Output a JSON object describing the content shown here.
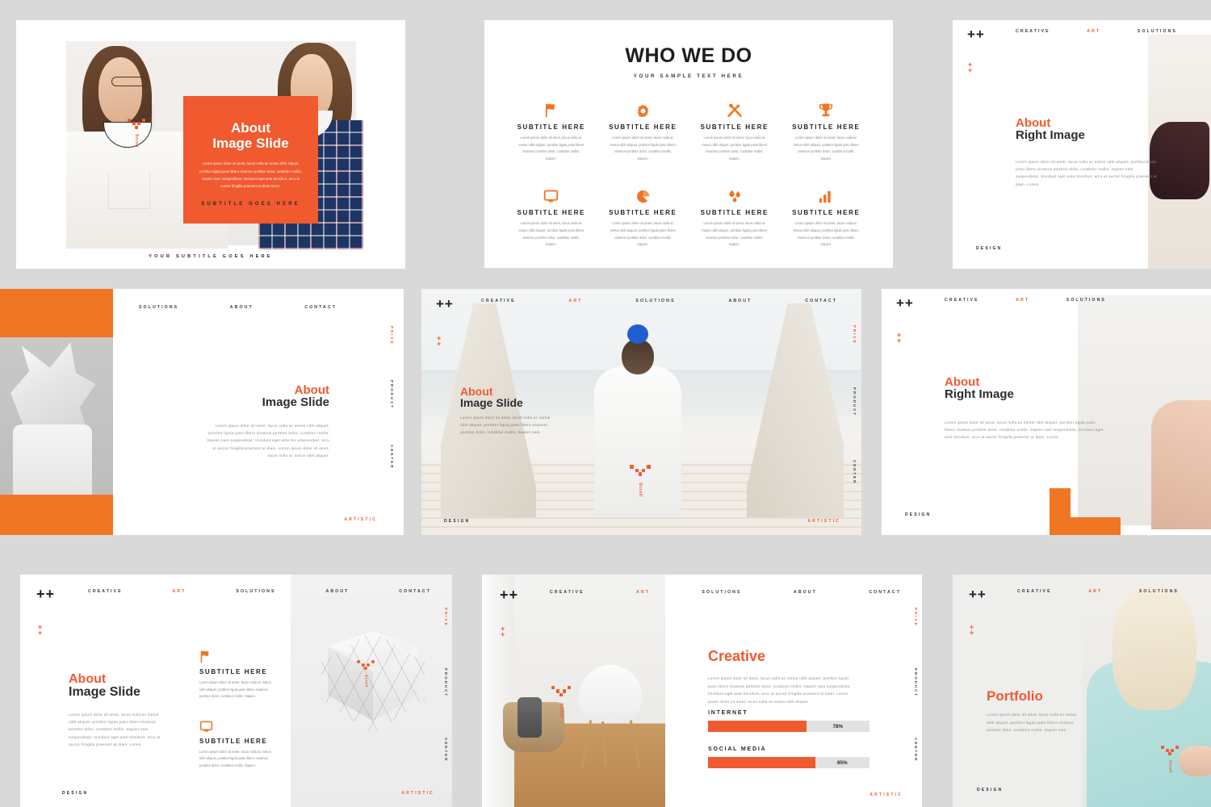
{
  "theme": {
    "accent": "#f05a2e",
    "accent_alt": "#ef7622",
    "page_bg": "#d9d9d9",
    "dark": "#2d2d2d"
  },
  "common": {
    "logo": "++",
    "mini_plus": "+",
    "scroll_word": "Scroll",
    "lorem_short": "Lorem ipsum dolor sit amet, lacus nulla ac metus nibh aliquet, porttitor ligula justo libero vivamus porttitor dolor, curabitur mollis.",
    "lorem_med": "Lorem ipsum dolor sit amet, lacus nulla ac metus nibh aliquet, porttitor ligula justo libero vivamus porttitor dolor, curabitur mollis. Sapien nam suspendisse, tincidunt eget ante tincidunt.",
    "lorem_long": "Lorem ipsum dolor sit amet, lacus nulla ac metus nibh aliquet, porttitor ligula justo libero vivamus porttitor dolor, curabitur mollis. Sapien nam suspendisse, tincidunt eget ante leo ullamcorper, arcu at auctor fringilla praesent at diam. Lorem ipsum dolor sit amet, lacus nulla ac metus nibh aliquet.",
    "lorem_card": "Lorem ipsum dolor sit amet, lacus nulla ac metus nibh aliquet, porttitor ligula justo libero vivamus porttitor dolor, curabitur mollis. Sapien.",
    "footer_design": "DESIGN",
    "footer_artistic": "ARTISTIC",
    "side_labels": [
      "PRICE",
      "PRODUCT",
      "CENTER"
    ]
  },
  "slide1": {
    "heading_line1": "About",
    "heading_line2": "Image Slide",
    "body": "Lorem ipsum dolor sit amet, lacus nulla ac metus nibh aliquet, porttitor ligula justo libero vivamus porttitor dolor, curabitur mollis, Sapien nam suspendisse, tincidunt eget ante tincidunt, arcu at auctor fringilla praesent at diam lorem.",
    "box_subtitle": "SUBTITLE GOES HERE",
    "footer": "YOUR SUBTITLE GOES HERE",
    "scroll": "Scroll"
  },
  "slide2": {
    "title": "WHO WE DO",
    "subtitle": "YOUR SAMPLE TEXT HERE",
    "items": [
      {
        "icon": "flag-icon",
        "heading": "SUBTITLE HERE",
        "body": "Lorem ipsum dolor sit amet, lacus nulla ac metus nibh aliquet, porttitor ligula justo libero vivamus porttitor dolor, curabitur mollis. Sapien."
      },
      {
        "icon": "gear-icon",
        "heading": "SUBTITLE HERE",
        "body": "Lorem ipsum dolor sit amet, lacus nulla ac metus nibh aliquet, porttitor ligula justo libero vivamus porttitor dolor, curabitur mollis. Sapien."
      },
      {
        "icon": "tools-icon",
        "heading": "SUBTITLE HERE",
        "body": "Lorem ipsum dolor sit amet, lacus nulla ac metus nibh aliquet, porttitor ligula justo libero vivamus porttitor dolor, curabitur mollis. Sapien."
      },
      {
        "icon": "trophy-icon",
        "heading": "SUBTITLE HERE",
        "body": "Lorem ipsum dolor sit amet, lacus nulla ac metus nibh aliquet, porttitor ligula justo libero vivamus porttitor dolor, curabitur mollis. Sapien."
      },
      {
        "icon": "monitor-icon",
        "heading": "SUBTITLE HERE",
        "body": "Lorem ipsum dolor sit amet, lacus nulla ac metus nibh aliquet, porttitor ligula justo libero vivamus porttitor dolor, curabitur mollis. Sapien."
      },
      {
        "icon": "pie-chart-icon",
        "heading": "SUBTITLE HERE",
        "body": "Lorem ipsum dolor sit amet, lacus nulla ac metus nibh aliquet, porttitor ligula justo libero vivamus porttitor dolor, curabitur mollis. Sapien."
      },
      {
        "icon": "water-drop-icon",
        "heading": "SUBTITLE HERE",
        "body": "Lorem ipsum dolor sit amet, lacus nulla ac metus nibh aliquet, porttitor ligula justo libero vivamus porttitor dolor, curabitur mollis. Sapien."
      },
      {
        "icon": "bar-chart-icon",
        "heading": "SUBTITLE HERE",
        "body": "Lorem ipsum dolor sit amet, lacus nulla ac metus nibh aliquet, porttitor ligula justo libero vivamus porttitor dolor, curabitur mollis. Sapien."
      }
    ]
  },
  "slide3": {
    "nav": [
      "CREATIVE",
      "ART",
      "SOLUTIONS"
    ],
    "heading_line1": "About",
    "heading_line2": "Right Image",
    "body": "Lorem ipsum dolor sit amet, lacus nulla ac metus nibh aliquet, porttitor ligula justo libero vivamus porttitor dolor, curabitur mollis. Sapien nam suspendisse, tincidunt eget ante tincidunt, arcu at auctor fringilla praesent at diam. Lorem.",
    "footer": "DESIGN"
  },
  "slide4": {
    "nav": [
      "SOLUTIONS",
      "ABOUT",
      "CONTACT"
    ],
    "side_labels": [
      "PRICE",
      "PRODUCT",
      "CENTER"
    ],
    "heading_line1": "About",
    "heading_line2": "Image Slide",
    "body": "Lorem ipsum dolor sit amet, lacus nulla ac metus nibh aliquet, porttitor ligula justo libero vivamus porttitor dolor, curabitur mollis. Sapien nam suspendisse, tincidunt eget ante leo ullamcorper, arcu at auctor fringilla praesent at diam. Lorem ipsum dolor sit amet, lacus nulla ac metus nibh aliquet.",
    "footer": "ARTISTIC"
  },
  "slide5": {
    "nav": [
      "CREATIVE",
      "ART",
      "SOLUTIONS",
      "ABOUT",
      "CONTACT"
    ],
    "side_labels": [
      "PRICE",
      "PRODUCT",
      "CENTER"
    ],
    "heading_line1": "About",
    "heading_line2": "Image Slide",
    "body": "Lorem ipsum dolor sit amet, lacus nulla ac metus nibh aliquet, porttitor ligula justo libero vivamus porttitor dolor, curabitur mollis. Sapien nam.",
    "footer_left": "DESIGN",
    "footer_right": "ARTISTIC",
    "scroll": "Scroll"
  },
  "slide6": {
    "nav": [
      "CREATIVE",
      "ART",
      "SOLUTIONS"
    ],
    "heading_line1": "About",
    "heading_line2": "Right Image",
    "body": "Lorem ipsum dolor sit amet, lacus nulla ac metus nibh aliquet, porttitor ligula justo libero vivamus porttitor dolor, curabitur mollis. Sapien nam suspendisse, tincidunt eget ante tincidunt, arcu at auctor fringilla praesent at diam. Lorem.",
    "footer": "DESIGN"
  },
  "slide7": {
    "nav": [
      "CREATIVE",
      "ART",
      "SOLUTIONS",
      "ABOUT",
      "CONTACT"
    ],
    "side_labels": [
      "PRICE",
      "PRODUCT",
      "CENTER"
    ],
    "heading_line1": "About",
    "heading_line2": "Image Slide",
    "body": "Lorem ipsum dolor sit amet, lacus nulla ac metus nibh aliquet, porttitor ligula justo libero vivamus porttitor dolor, curabitur mollis. Sapien nam suspendisse, tincidunt eget ante tincidunt, arcu at auctor fringilla praesent at diam. Lorem.",
    "features": [
      {
        "icon": "flag-icon",
        "heading": "SUBTITLE HERE",
        "body": "Lorem ipsum dolor sit amet, lacus nulla ac metus nibh aliquet, porttitor ligula justo libero vivamus porttitor dolor, curabitur mollis. Sapien."
      },
      {
        "icon": "monitor-icon",
        "heading": "SUBTITLE HERE",
        "body": "Lorem ipsum dolor sit amet, lacus nulla ac metus nibh aliquet, porttitor ligula justo libero vivamus porttitor dolor, curabitur mollis. Sapien."
      }
    ],
    "footer_left": "DESIGN",
    "footer_right": "ARTISTIC",
    "scroll": "Scroll"
  },
  "slide8": {
    "nav": [
      "CREATIVE",
      "ART",
      "SOLUTIONS",
      "ABOUT",
      "CONTACT"
    ],
    "side_labels": [
      "PRICE",
      "PRODUCT",
      "CENTER"
    ],
    "heading": "Creative",
    "body": "Lorem ipsum dolor sit amet, lacus nulla ac metus nibh aliquet, porttitor ligula justo libero vivamus porttitor dolor, curabitur mollis. Sapien nam suspendisse, tincidunt eget ante tincidunt, arcu at auctor fringilla praesent at diam. Lorem ipsum dolor sit amet, lacus nulla ac metus nibh aliquet.",
    "footer_right": "ARTISTIC",
    "scroll": "Scroll",
    "chart_data": {
      "type": "bar",
      "title": "Creative",
      "orientation": "horizontal",
      "categories": [
        "INTERNET",
        "SOCIAL MEDIA"
      ],
      "values": [
        78,
        85
      ],
      "value_labels": [
        "78%",
        "85%"
      ],
      "unit": "%",
      "xlim": [
        0,
        100
      ],
      "grid": false,
      "legend": "none",
      "bar_color": "#f05a2e",
      "track_color": "#e2e2e2"
    }
  },
  "slide9": {
    "nav": [
      "CREATIVE",
      "ART",
      "SOLUTIONS"
    ],
    "heading": "Portfolio",
    "body": "Lorem ipsum dolor sit amet, lacus nulla ac metus nibh aliquet, porttitor ligula justo libero vivamus porttitor dolor, curabitur mollis. Sapien nam.",
    "footer": "DESIGN",
    "scroll": "Scroll"
  }
}
